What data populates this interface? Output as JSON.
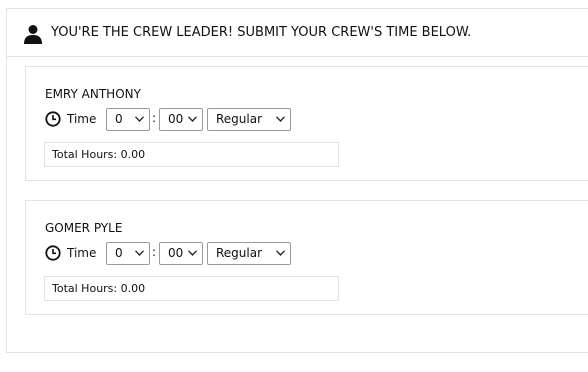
{
  "header": {
    "title": "YOU'RE THE CREW LEADER! SUBMIT YOUR CREW'S TIME BELOW.",
    "icon": "user-icon"
  },
  "crew": [
    {
      "name": "EMRY ANTHONY",
      "time_label": "Time",
      "hours": "0",
      "minutes": "00",
      "separator": ":",
      "type": "Regular",
      "total": "Total Hours: 0.00"
    },
    {
      "name": "GOMER PYLE",
      "time_label": "Time",
      "hours": "0",
      "minutes": "00",
      "separator": ":",
      "type": "Regular",
      "total": "Total Hours: 0.00"
    }
  ]
}
